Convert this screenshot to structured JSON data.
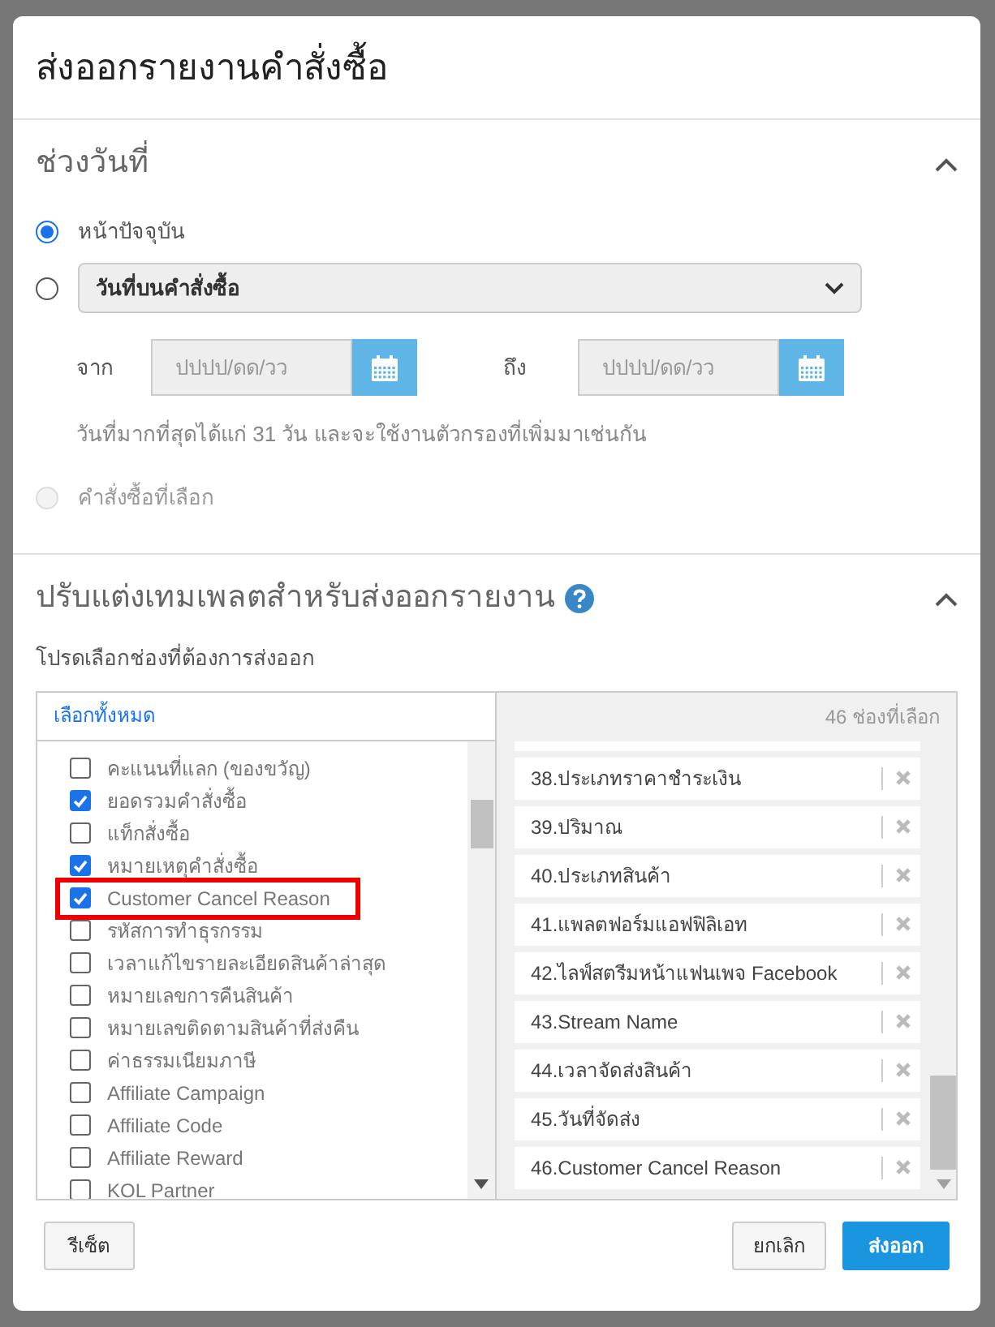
{
  "dialog": {
    "title": "ส่งออกรายงานคำสั่งซื้อ"
  },
  "date_section": {
    "title": "ช่วงวันที่",
    "expanded": true,
    "options": [
      {
        "kind": "plain",
        "label": "หน้าปัจจุบัน",
        "selected": true,
        "disabled": false
      },
      {
        "kind": "select",
        "value": "วันที่บนคำสั่งซื้อ",
        "selected": false,
        "disabled": false
      },
      {
        "kind": "plain",
        "label": "คำสั่งซื้อที่เลือก",
        "selected": false,
        "disabled": true
      }
    ],
    "from_label": "จาก",
    "from_placeholder": "ปปปป/ดด/วว",
    "to_label": "ถึง",
    "to_placeholder": "ปปปป/ดด/วว",
    "hint": "วันที่มากที่สุดได้แก่ 31 วัน และจะใช้งานตัวกรองที่เพิ่มมาเช่นกัน"
  },
  "template_section": {
    "title": "ปรับแต่งเทมเพลตสำหรับส่งออกรายงาน",
    "expanded": true,
    "subtitle": "โปรดเลือกช่องที่ต้องการส่งออก",
    "select_all": "เลือกทั้งหมด",
    "selected_count": "46 ช่องที่เลือก",
    "fields": [
      {
        "label": "คะแนนที่แลก (ของขวัญ)",
        "checked": false,
        "highlighted": false
      },
      {
        "label": "ยอดรวมคำสั่งซื้อ",
        "checked": true,
        "highlighted": false
      },
      {
        "label": "แท็กสั่งซื้อ",
        "checked": false,
        "highlighted": false
      },
      {
        "label": "หมายเหตุคำสั่งซื้อ",
        "checked": true,
        "highlighted": false
      },
      {
        "label": "Customer Cancel Reason",
        "checked": true,
        "highlighted": true
      },
      {
        "label": "รหัสการทำธุรกรรม",
        "checked": false,
        "highlighted": false
      },
      {
        "label": "เวลาแก้ไขรายละเอียดสินค้าล่าสุด",
        "checked": false,
        "highlighted": false
      },
      {
        "label": "หมายเลขการคืนสินค้า",
        "checked": false,
        "highlighted": false
      },
      {
        "label": "หมายเลขติดตามสินค้าที่ส่งคืน",
        "checked": false,
        "highlighted": false
      },
      {
        "label": "ค่าธรรมเนียมภาษี",
        "checked": false,
        "highlighted": false
      },
      {
        "label": "Affiliate Campaign",
        "checked": false,
        "highlighted": false
      },
      {
        "label": "Affiliate Code",
        "checked": false,
        "highlighted": false
      },
      {
        "label": "Affiliate Reward",
        "checked": false,
        "highlighted": false
      },
      {
        "label": "KOL Partner",
        "checked": false,
        "highlighted": false
      }
    ],
    "chosen": [
      "38.ประเภทราคาชำระเงิน",
      "39.ปริมาณ",
      "40.ประเภทสินค้า",
      "41.แพลตฟอร์มแอฟฟิลิเอท",
      "42.ไลฟ์สตรีมหน้าแฟนเพจ Facebook",
      "43.Stream Name",
      "44.เวลาจัดส่งสินค้า",
      "45.วันที่จัดส่ง",
      "46.Customer Cancel Reason"
    ]
  },
  "buttons": {
    "reset": "รีเซ็ต",
    "cancel": "ยกเลิก",
    "export": "ส่งออก"
  }
}
